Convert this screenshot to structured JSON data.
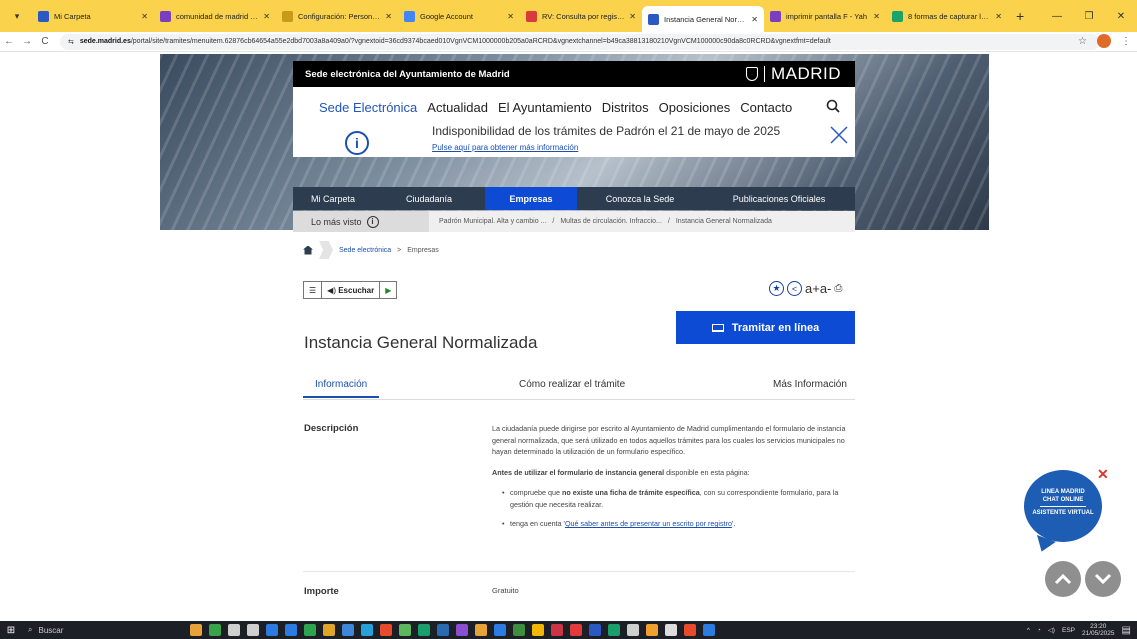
{
  "browser": {
    "tabs": [
      {
        "title": "Mi Carpeta",
        "fav": "#2b59c3",
        "active": false
      },
      {
        "title": "comunidad de madrid seu",
        "fav": "#7a3fc0",
        "active": false
      },
      {
        "title": "Configuración: Personaliz",
        "fav": "#c79a1a",
        "active": false
      },
      {
        "title": "Google Account",
        "fav": "#4285f4",
        "active": false
      },
      {
        "title": "RV: Consulta por registro",
        "fav": "#d93a3a",
        "active": false
      },
      {
        "title": "Instancia General Normal",
        "fav": "#2b59c3",
        "active": true
      },
      {
        "title": "imprimir pantalla F - Yah",
        "fav": "#7a3fc0",
        "active": false
      },
      {
        "title": "8 formas de capturar la p",
        "fav": "#1aa36b",
        "active": false
      }
    ],
    "url_host": "sede.madrid.es",
    "url_rest": "/portal/site/tramites/menuitem.62876cb64654a55e2dbd7003a8a409a0/?vgnextoid=36cd9374bcaed010VgnVCM1000000b205a0aRCRD&vgnextchannel=b49ca38813180210VgnVCM100000c90da8c0RCRD&vgnextfmt=default"
  },
  "header": {
    "site_title": "Sede electrónica del Ayuntamiento de Madrid",
    "logo_text": "MADRID",
    "main_nav": [
      "Sede Electrónica",
      "Actualidad",
      "El Ayuntamiento",
      "Distritos",
      "Oposiciones",
      "Contacto"
    ],
    "notice": {
      "title": "Indisponibilidad de los trámites de Padrón el 21 de mayo de 2025",
      "link": "Pulse aquí para obtener más información"
    },
    "sub_nav": [
      "Mi Carpeta",
      "Ciudadanía",
      "Empresas",
      "Conozca la Sede",
      "Publicaciones Oficiales"
    ],
    "sub_nav_active": "Empresas",
    "popular": {
      "label": "Lo más visto",
      "items": [
        "Padrón Municipal. Alta y cambio ...",
        "/",
        "Multas de circulación. Infraccio...",
        "/",
        "Instancia General Normalizada"
      ]
    },
    "breadcrumb": {
      "link": "Sede electrónica",
      "sep": ">",
      "current": "Empresas"
    }
  },
  "content": {
    "listen_label": "Escuchar",
    "tools_text": "a+a-",
    "tramitar_label": "Tramitar en línea",
    "page_title": "Instancia General Normalizada",
    "tabs": [
      "Información",
      "Cómo realizar el trámite",
      "Más Información"
    ],
    "descripcion_label": "Descripción",
    "desc_p1": "La ciudadanía puede dirigirse por escrito al Ayuntamiento de Madrid cumplimentando el formulario de instancia general normalizada, que será utilizado en todos aquellos trámites para los cuales los servicios municipales no hayan determinado la utilización de un formulario específico.",
    "desc_p2_bold": "Antes de utilizar el formulario de instancia general",
    "desc_p2_rest": " disponible en esta página:",
    "bullet1_a": "compruebe que ",
    "bullet1_bold": "no existe una ficha de trámite específica",
    "bullet1_b": ", con su correspondiente formulario, para la gestión que necesita realizar.",
    "bullet2_a": "tenga en cuenta '",
    "bullet2_link": "Qué saber antes de presentar un escrito por registro",
    "bullet2_b": "'.",
    "importe_label": "Importe",
    "importe_value": "Gratuito"
  },
  "chat": {
    "line1": "LINEA MADRID",
    "line2": "CHAT ONLINE",
    "line3": "ASISTENTE VIRTUAL"
  },
  "taskbar": {
    "search": "Buscar",
    "lang": "ESP",
    "time": "23:20",
    "date": "21/05/2025",
    "apps": [
      "#e8a23a",
      "#3aa34a",
      "#cfcfcf",
      "#cfcfcf",
      "#2b7be0",
      "#2b7be0",
      "#2ea44f",
      "#e0a52b",
      "#3d86d8",
      "#25a0d8",
      "#e84a2c",
      "#5cb85c",
      "#1a9e6b",
      "#2a6ab0",
      "#8a4fd0",
      "#e8a23a",
      "#2b7be0",
      "#3d8f3d",
      "#f2b705",
      "#cc3344",
      "#e23b3b",
      "#2b59c3",
      "#1a9e6b",
      "#cfcfcf",
      "#f0a030",
      "#dddddd",
      "#e84a2c",
      "#2b7be0"
    ]
  }
}
